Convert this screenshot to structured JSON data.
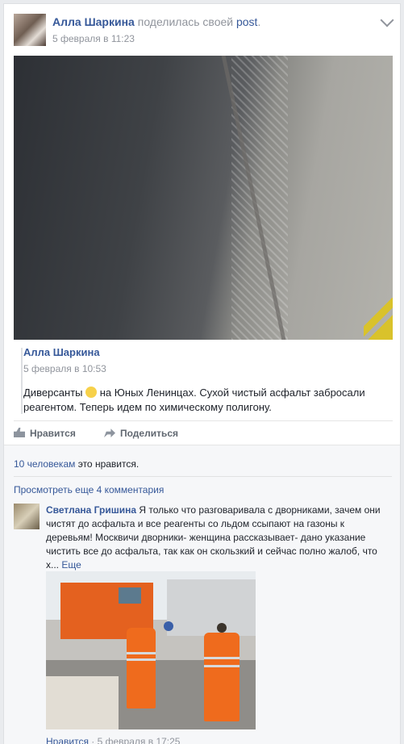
{
  "post": {
    "author": "Алла Шаркина",
    "action_text": "поделилась своей",
    "action_link": "post",
    "period": ".",
    "timestamp": "5 февраля в 11:23"
  },
  "shared": {
    "author": "Алла Шаркина",
    "timestamp": "5 февраля в 10:53",
    "text_before": "Диверсанты",
    "text_after": " на Юных Ленинцах. Сухой чистый асфальт забросали реагентом. Теперь идем по химическому полигону."
  },
  "actions": {
    "like": "Нравится",
    "share": "Поделиться"
  },
  "likes": {
    "count_link": "10 человекам",
    "text": " это нравится."
  },
  "comments_more": "Просмотреть еще 4 комментария",
  "comment": {
    "author": "Светлана Гришина",
    "text": " Я только что разговаривала с дворниками, зачем они чистят до асфальта и все реагенты со льдом ссыпают на газоны к деревьям! Москвичи дворники- женщина рассказывает- дано указание чистить все до асфальта, так как он скользкий и сейчас полно жалоб, что х...",
    "more": "Еще",
    "like": "Нравится",
    "dot": " · ",
    "timestamp": "5 февраля в 17:25"
  }
}
